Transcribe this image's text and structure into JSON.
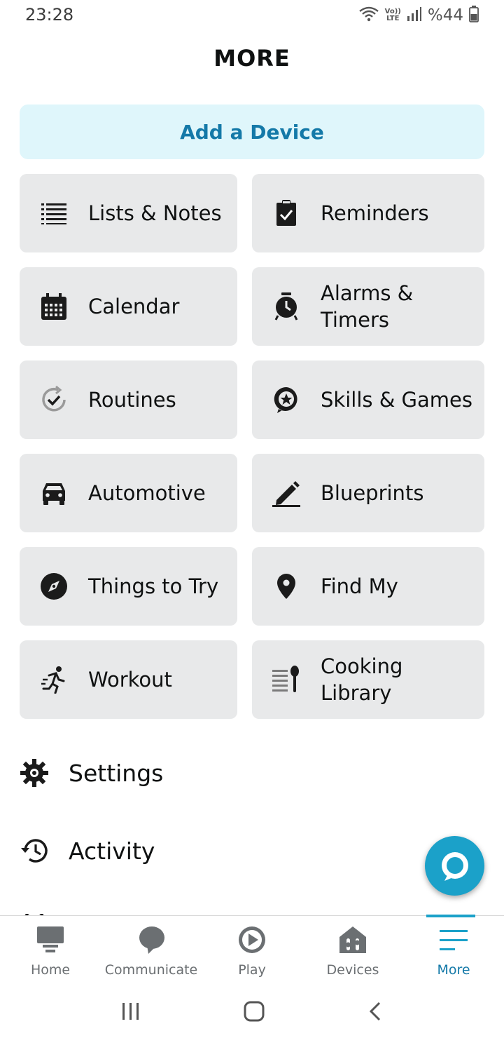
{
  "status_bar": {
    "time": "23:28",
    "volte_top": "Vo))",
    "volte_bottom": "LTE",
    "battery": "%44"
  },
  "page": {
    "title": "MORE"
  },
  "add_device": {
    "label": "Add a Device"
  },
  "tiles": [
    {
      "label": "Lists & Notes",
      "icon": "list-icon"
    },
    {
      "label": "Reminders",
      "icon": "clipboard-check-icon"
    },
    {
      "label": "Calendar",
      "icon": "calendar-icon"
    },
    {
      "label": "Alarms & Timers",
      "icon": "alarm-clock-icon"
    },
    {
      "label": "Routines",
      "icon": "routine-check-icon"
    },
    {
      "label": "Skills & Games",
      "icon": "skills-star-icon"
    },
    {
      "label": "Automotive",
      "icon": "car-icon"
    },
    {
      "label": "Blueprints",
      "icon": "pencil-icon"
    },
    {
      "label": "Things to Try",
      "icon": "compass-icon"
    },
    {
      "label": "Find My",
      "icon": "location-pin-icon"
    },
    {
      "label": "Workout",
      "icon": "running-person-icon"
    },
    {
      "label": "Cooking Library",
      "icon": "cooking-spoon-icon"
    }
  ],
  "list_items": [
    {
      "label": "Settings",
      "icon": "gear-icon"
    },
    {
      "label": "Activity",
      "icon": "history-icon"
    }
  ],
  "bottom_nav": [
    {
      "label": "Home",
      "icon": "home-icon",
      "active": false
    },
    {
      "label": "Communicate",
      "icon": "chat-bubble-icon",
      "active": false
    },
    {
      "label": "Play",
      "icon": "play-icon",
      "active": false
    },
    {
      "label": "Devices",
      "icon": "devices-icon",
      "active": false
    },
    {
      "label": "More",
      "icon": "hamburger-menu-icon",
      "active": true
    }
  ],
  "colors": {
    "accent": "#1479a8",
    "fab": "#1ba1c9",
    "tile_bg": "#e8e9ea",
    "add_device_bg": "#dff6fb"
  }
}
